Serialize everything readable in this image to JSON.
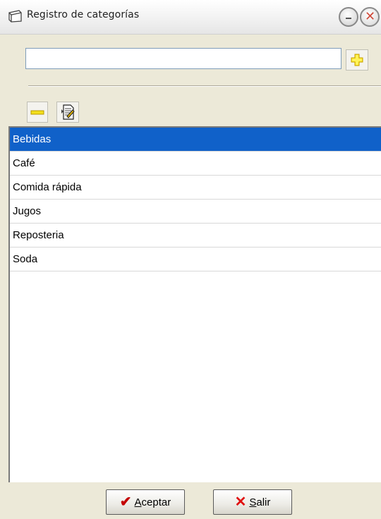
{
  "window": {
    "title": "Registro de categorías"
  },
  "form": {
    "category_value": "",
    "add_icon": "plus-icon",
    "remove_icon": "minus-icon",
    "edit_icon": "document-edit-icon"
  },
  "list": {
    "items": [
      {
        "label": "Bebidas",
        "selected": true
      },
      {
        "label": "Café",
        "selected": false
      },
      {
        "label": "Comida rápida",
        "selected": false
      },
      {
        "label": "Jugos",
        "selected": false
      },
      {
        "label": "Reposteria",
        "selected": false
      },
      {
        "label": "Soda",
        "selected": false
      }
    ],
    "selection_color": "#1061c9"
  },
  "buttons": {
    "accept": {
      "label_first": "A",
      "label_rest": "ceptar",
      "icon": "checkmark-icon"
    },
    "exit": {
      "label_first": "S",
      "label_rest": "alir",
      "icon": "x-icon"
    }
  }
}
